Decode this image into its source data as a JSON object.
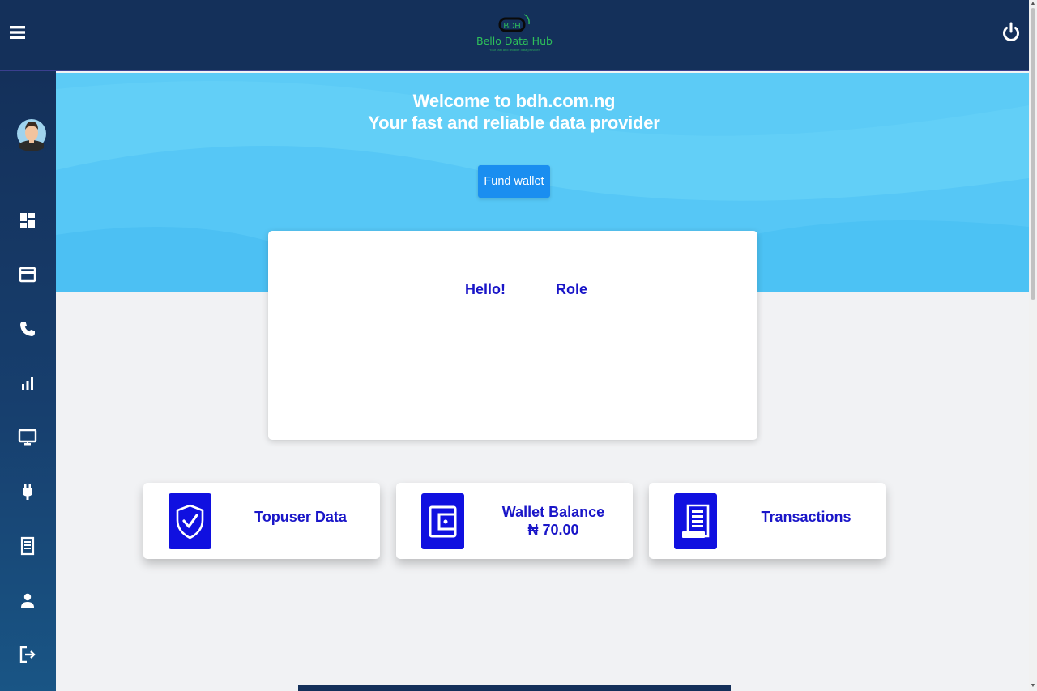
{
  "header": {
    "logo_mark_text": "BDH",
    "logo_name": "Bello Data Hub",
    "logo_tagline": "Your fast and reliable data provider",
    "menu_icon": "hamburger-menu-icon",
    "power_icon": "power-icon"
  },
  "sidebar": {
    "icons": [
      "dashboard-icon",
      "card-icon",
      "phone-icon",
      "bar-chart-icon",
      "monitor-icon",
      "plug-icon",
      "receipt-icon",
      "user-icon",
      "logout-icon"
    ]
  },
  "hero": {
    "title_line1": "Welcome to bdh.com.ng",
    "title_line2": "Your fast and reliable data provider",
    "fund_wallet_label": "Fund wallet"
  },
  "welcome_card": {
    "hello": "Hello!",
    "role": "Role"
  },
  "stats": [
    {
      "label": "Topuser Data",
      "icon": "shield-check-icon"
    },
    {
      "label": "Wallet Balance",
      "value": "₦ 70.00",
      "icon": "wallet-icon"
    },
    {
      "label": "Transactions",
      "icon": "receipt-icon"
    }
  ],
  "colors": {
    "header_bg": "#14305a",
    "hero_bg": "#62cff7",
    "accent_blue": "#1a16c8",
    "button_blue": "#1a8ef0",
    "logo_green": "#2ec05a"
  }
}
